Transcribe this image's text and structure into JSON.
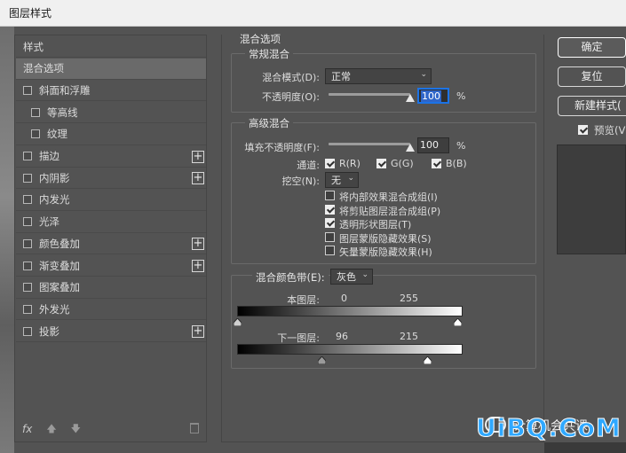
{
  "window": {
    "title": "图层样式"
  },
  "left_panel": {
    "items": [
      {
        "label": "样式",
        "checkbox": false,
        "plus": false,
        "indent": 0,
        "selected": false
      },
      {
        "label": "混合选项",
        "checkbox": false,
        "plus": false,
        "indent": 0,
        "selected": true
      },
      {
        "label": "斜面和浮雕",
        "checkbox": true,
        "plus": false,
        "indent": 0,
        "selected": false
      },
      {
        "label": "等高线",
        "checkbox": true,
        "plus": false,
        "indent": 1,
        "selected": false
      },
      {
        "label": "纹理",
        "checkbox": true,
        "plus": false,
        "indent": 1,
        "selected": false
      },
      {
        "label": "描边",
        "checkbox": true,
        "plus": true,
        "indent": 0,
        "selected": false
      },
      {
        "label": "内阴影",
        "checkbox": true,
        "plus": true,
        "indent": 0,
        "selected": false
      },
      {
        "label": "内发光",
        "checkbox": true,
        "plus": false,
        "indent": 0,
        "selected": false
      },
      {
        "label": "光泽",
        "checkbox": true,
        "plus": false,
        "indent": 0,
        "selected": false
      },
      {
        "label": "颜色叠加",
        "checkbox": true,
        "plus": true,
        "indent": 0,
        "selected": false
      },
      {
        "label": "渐变叠加",
        "checkbox": true,
        "plus": true,
        "indent": 0,
        "selected": false
      },
      {
        "label": "图案叠加",
        "checkbox": true,
        "plus": false,
        "indent": 0,
        "selected": false
      },
      {
        "label": "外发光",
        "checkbox": true,
        "plus": false,
        "indent": 0,
        "selected": false
      },
      {
        "label": "投影",
        "checkbox": true,
        "plus": true,
        "indent": 0,
        "selected": false
      }
    ],
    "footer": {
      "fx_label": "fx",
      "up_arrow": "🡅",
      "down_arrow": "🡇"
    }
  },
  "blend_options": {
    "title": "混合选项",
    "general": {
      "title": "常规混合",
      "blend_mode_label": "混合模式(D):",
      "blend_mode_value": "正常",
      "opacity_label": "不透明度(O):",
      "opacity_value": "100",
      "opacity_fraction": 1.0,
      "percent": "%"
    },
    "advanced": {
      "title": "高级混合",
      "fill_label": "填充不透明度(F):",
      "fill_value": "100",
      "fill_fraction": 1.0,
      "percent": "%",
      "channels_label": "通道:",
      "channel_r": "R(R)",
      "channel_g": "G(G)",
      "channel_b": "B(B)",
      "knockout_label": "挖空(N):",
      "knockout_value": "无",
      "options": [
        {
          "label": "将内部效果混合成组(I)",
          "checked": false
        },
        {
          "label": "将剪贴图层混合成组(P)",
          "checked": true
        },
        {
          "label": "透明形状图层(T)",
          "checked": true
        },
        {
          "label": "图层蒙版隐藏效果(S)",
          "checked": false
        },
        {
          "label": "矢量蒙版隐藏效果(H)",
          "checked": false
        }
      ]
    },
    "blend_if": {
      "label": "混合颜色带(E):",
      "value": "灰色",
      "this_layer_label": "本图层:",
      "this_layer_min": "0",
      "this_layer_max": "255",
      "this_layer_min_frac": 0.0,
      "this_layer_max_frac": 1.0,
      "underlying_label": "下一图层:",
      "underlying_min": "96",
      "underlying_max": "215",
      "underlying_min_frac": 0.376,
      "underlying_max_frac": 0.843
    }
  },
  "right_panel": {
    "ok_label": "确定",
    "reset_label": "复位",
    "new_style_label": "新建样式(",
    "preview_label": "预览(V"
  },
  "watermark": {
    "text": "UiBQ.CoM",
    "cn_text": "计算机会共课"
  }
}
